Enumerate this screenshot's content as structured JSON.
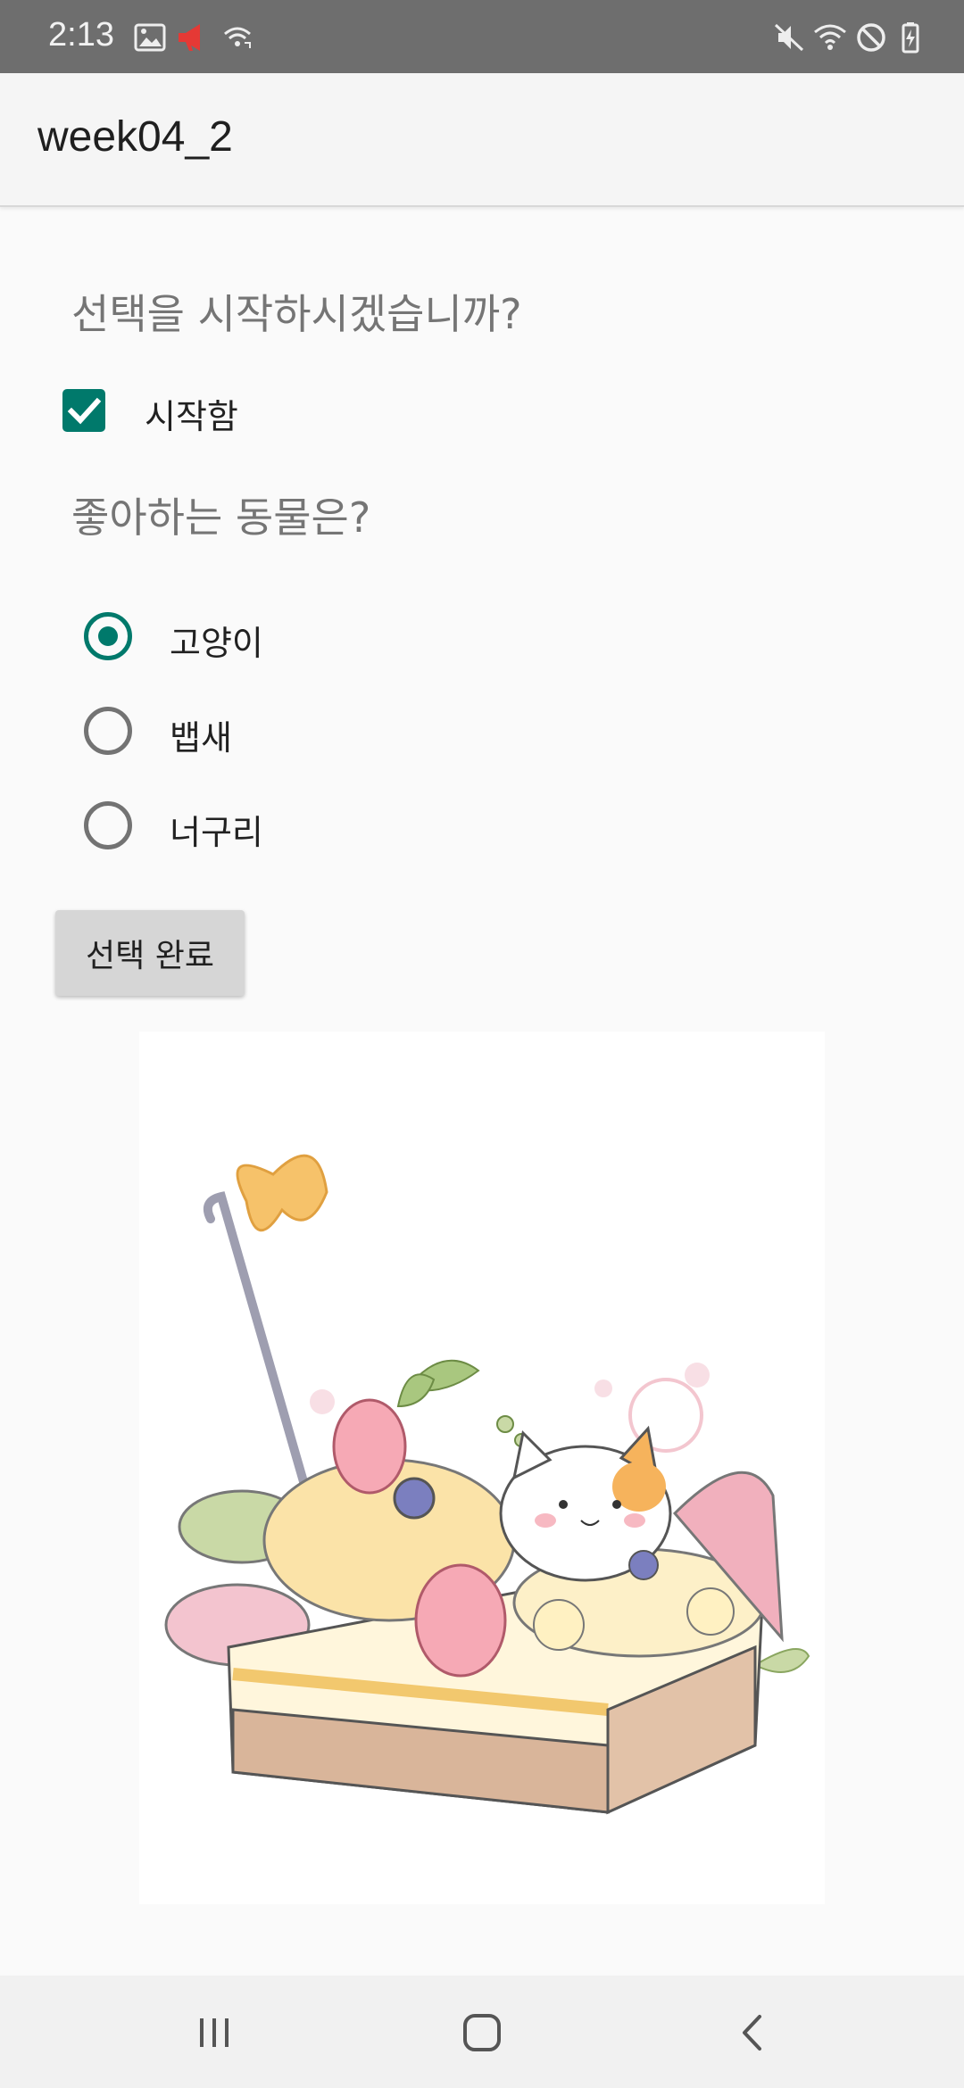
{
  "status_bar": {
    "time": "2:13",
    "left_icons": [
      "image-icon",
      "megaphone-icon",
      "wifi-calling-icon"
    ],
    "right_icons": [
      "mute-icon",
      "wifi-icon",
      "do-not-disturb-icon",
      "battery-charging-icon"
    ],
    "alert_color": "#e53935"
  },
  "app_bar": {
    "title": "week04_2"
  },
  "content": {
    "question_start": "선택을 시작하시겠습니까?",
    "checkbox": {
      "label": "시작함",
      "checked": true
    },
    "question_animal": "좋아하는 동물은?",
    "radio_options": [
      {
        "label": "고양이",
        "checked": true
      },
      {
        "label": "뱁새",
        "checked": false
      },
      {
        "label": "너구리",
        "checked": false
      }
    ],
    "done_button": "선택 완료",
    "image": {
      "subject": "cat-cake-illustration"
    }
  },
  "nav_bar": {
    "buttons": [
      "recent-apps-icon",
      "home-icon",
      "back-icon"
    ]
  },
  "colors": {
    "accent": "#00796b",
    "background": "#fafafa"
  }
}
